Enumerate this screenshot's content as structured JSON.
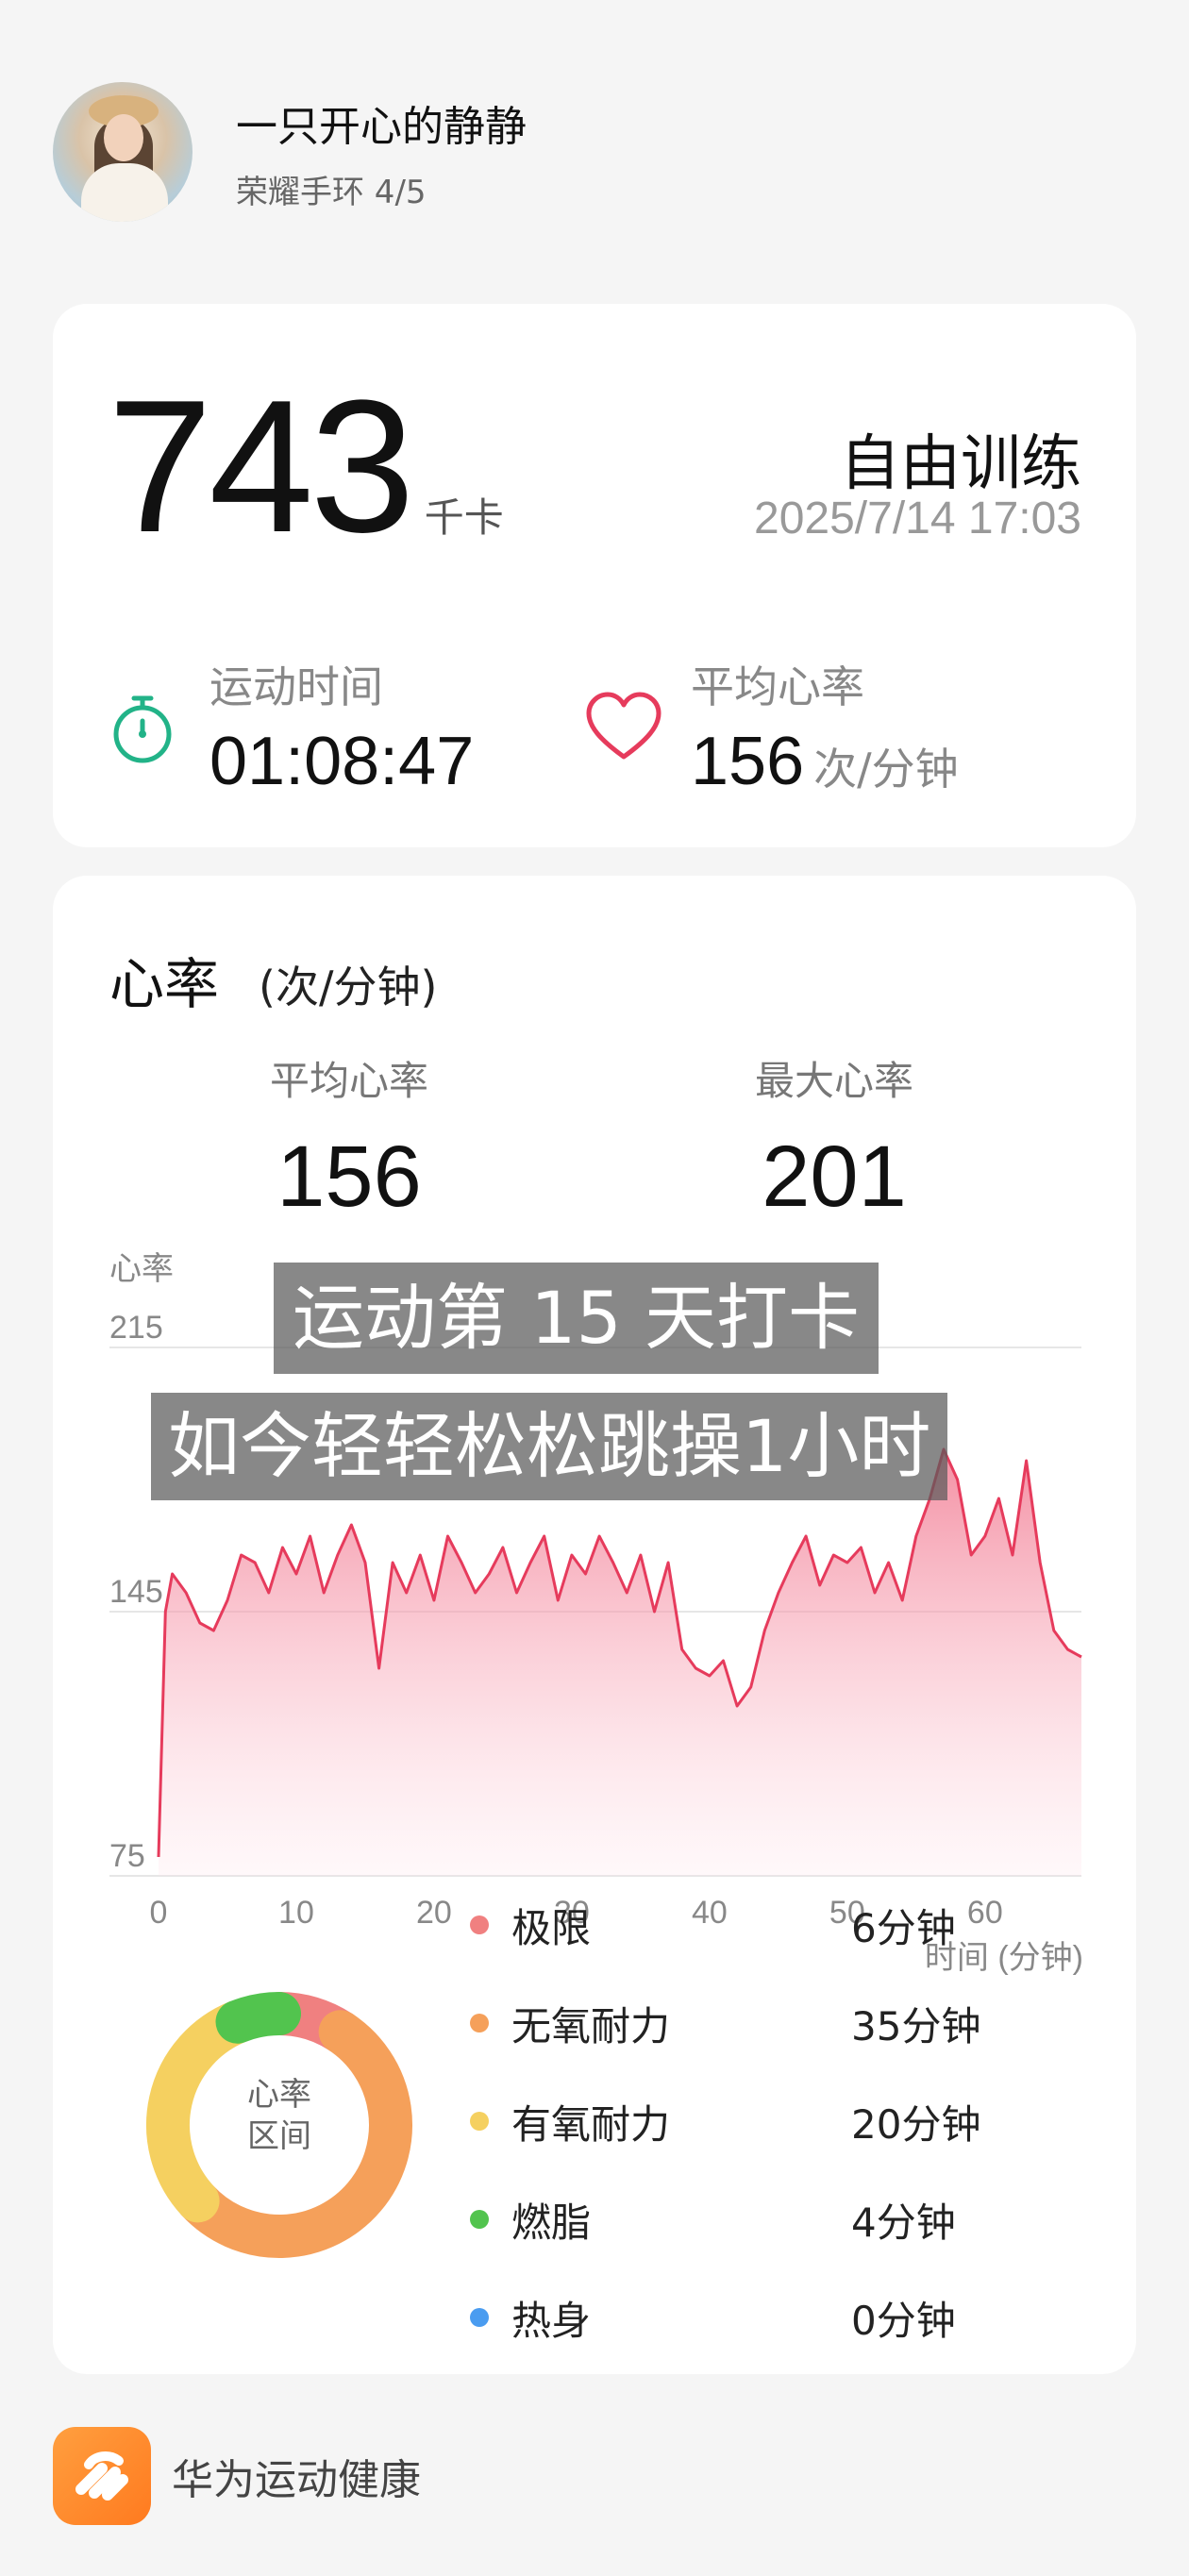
{
  "profile": {
    "user_name": "一只开心的静静",
    "device": "荣耀手环 4/5"
  },
  "summary_card": {
    "calories_value": "743",
    "calories_unit": "千卡",
    "workout_type": "自由训练",
    "datetime": "2025/7/14 17:03",
    "duration_label": "运动时间",
    "duration_value": "01:08:47",
    "avg_hr_label": "平均心率",
    "avg_hr_value": "156",
    "avg_hr_unit": "次/分钟"
  },
  "hr_card": {
    "title": "心率",
    "title_unit": "(次/分钟)",
    "avg_label": "平均心率",
    "avg_value": "156",
    "max_label": "最大心率",
    "max_value": "201",
    "overlay_line1": "运动第 15 天打卡",
    "overlay_line2": "如今轻轻松松跳操1小时",
    "donut_label_line1": "心率",
    "donut_label_line2": "区间"
  },
  "chart_data": {
    "type": "area",
    "ylabel": "心率",
    "xlabel": "时间 (分钟)",
    "xlim": [
      0,
      67
    ],
    "ylim": [
      75,
      215
    ],
    "xticks": [
      0,
      10,
      20,
      30,
      40,
      50,
      60
    ],
    "yticks": [
      75,
      145,
      215
    ],
    "grid": "horizontal",
    "x": [
      0,
      0.5,
      1,
      2,
      3,
      4,
      5,
      6,
      7,
      8,
      9,
      10,
      11,
      12,
      13,
      14,
      15,
      16,
      17,
      18,
      19,
      20,
      21,
      22,
      23,
      24,
      25,
      26,
      27,
      28,
      29,
      30,
      31,
      32,
      33,
      34,
      35,
      36,
      37,
      38,
      39,
      40,
      41,
      42,
      43,
      44,
      45,
      46,
      47,
      48,
      49,
      50,
      51,
      52,
      53,
      54,
      55,
      56,
      57,
      58,
      59,
      60,
      61,
      62,
      63,
      64,
      65,
      66,
      67
    ],
    "values": [
      80,
      145,
      155,
      150,
      142,
      140,
      148,
      160,
      158,
      150,
      162,
      155,
      165,
      150,
      160,
      168,
      158,
      130,
      158,
      150,
      160,
      148,
      165,
      158,
      150,
      155,
      162,
      150,
      158,
      165,
      148,
      160,
      155,
      165,
      158,
      150,
      160,
      145,
      158,
      135,
      130,
      128,
      132,
      120,
      125,
      140,
      150,
      158,
      165,
      152,
      160,
      158,
      162,
      150,
      158,
      148,
      165,
      175,
      188,
      180,
      160,
      165,
      175,
      160,
      185,
      158,
      140,
      135,
      133
    ],
    "series_color": "#e63b5c"
  },
  "zones": [
    {
      "name": "极限",
      "value": "6分钟",
      "minutes": 6,
      "color": "#f08080"
    },
    {
      "name": "无氧耐力",
      "value": "35分钟",
      "minutes": 35,
      "color": "#f5a05a"
    },
    {
      "name": "有氧耐力",
      "value": "20分钟",
      "minutes": 20,
      "color": "#f5d060"
    },
    {
      "name": "燃脂",
      "value": "4分钟",
      "minutes": 4,
      "color": "#52c44e"
    },
    {
      "name": "热身",
      "value": "0分钟",
      "minutes": 0,
      "color": "#4a9cf0"
    }
  ],
  "footer": {
    "brand_name": "华为运动健康"
  },
  "colors": {
    "accent_green": "#22b388",
    "accent_red": "#e63b5c",
    "brand_orange": "#ff8a2a"
  }
}
